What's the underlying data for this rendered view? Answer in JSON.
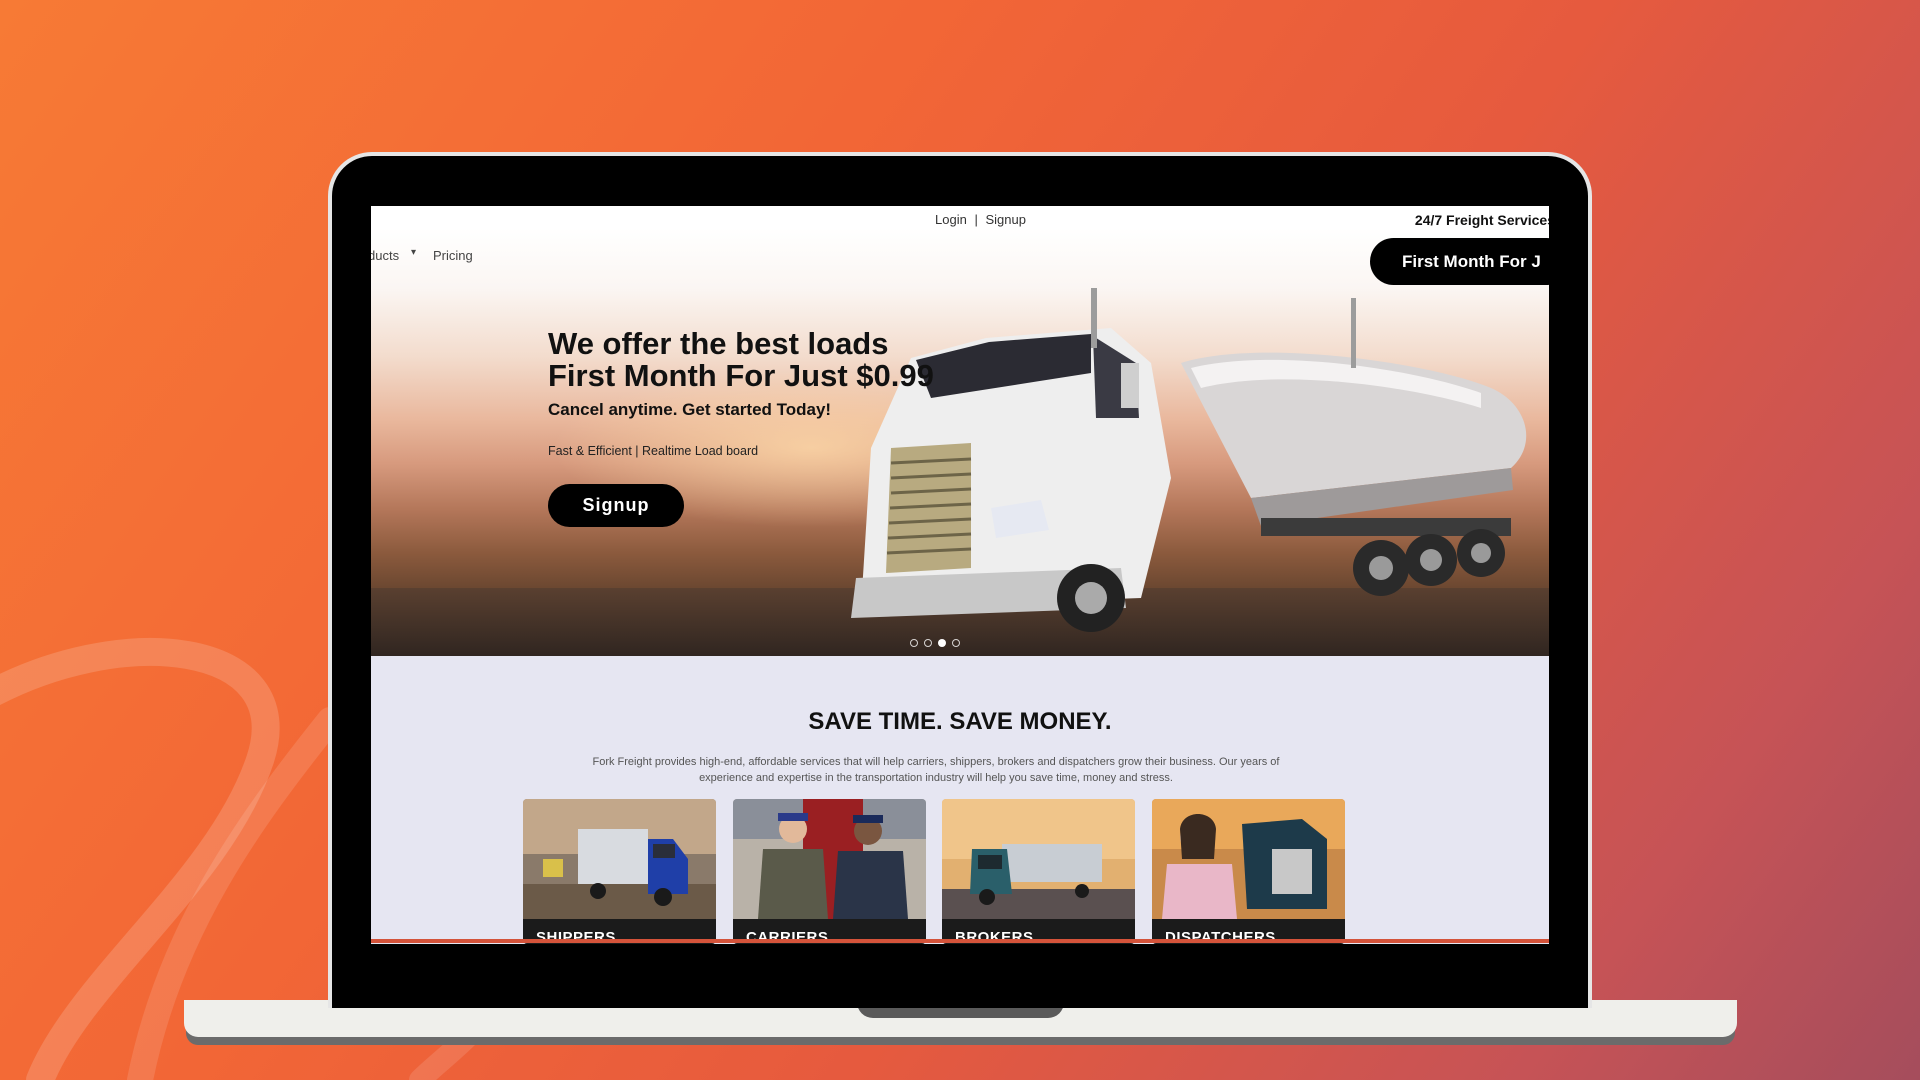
{
  "page": {
    "auth": {
      "login": "Login",
      "separator": "|",
      "signup": "Signup"
    },
    "services_text": "24/7 Freight Services",
    "nav": {
      "products": "ducts",
      "pricing": "Pricing"
    },
    "promo_pill": "First Month For J",
    "hero": {
      "title_line1": "We offer the best loads",
      "title_line2": "First Month For Just $0.99",
      "subtitle": "Cancel anytime. Get started Today!",
      "tagline": "Fast & Efficient | Realtime Load board",
      "cta": "Signup",
      "slides_count": 4,
      "active_slide": 3
    },
    "section": {
      "title": "SAVE TIME. SAVE MONEY.",
      "description": "Fork Freight provides high-end, affordable services that will help carriers, shippers, brokers and dispatchers grow their business. Our years of experience and expertise in the transportation industry will help you save time, money and stress.",
      "cards": [
        {
          "label": "SHIPPERS"
        },
        {
          "label": "CARRIERS"
        },
        {
          "label": "BROKERS"
        },
        {
          "label": "DISPATCHERS"
        }
      ]
    }
  },
  "colors": {
    "background_start": "#f77a35",
    "background_end": "#a54d5c",
    "button_bg": "#000000",
    "section_bg": "#e6e6f2",
    "accent_line": "#d4533a"
  }
}
